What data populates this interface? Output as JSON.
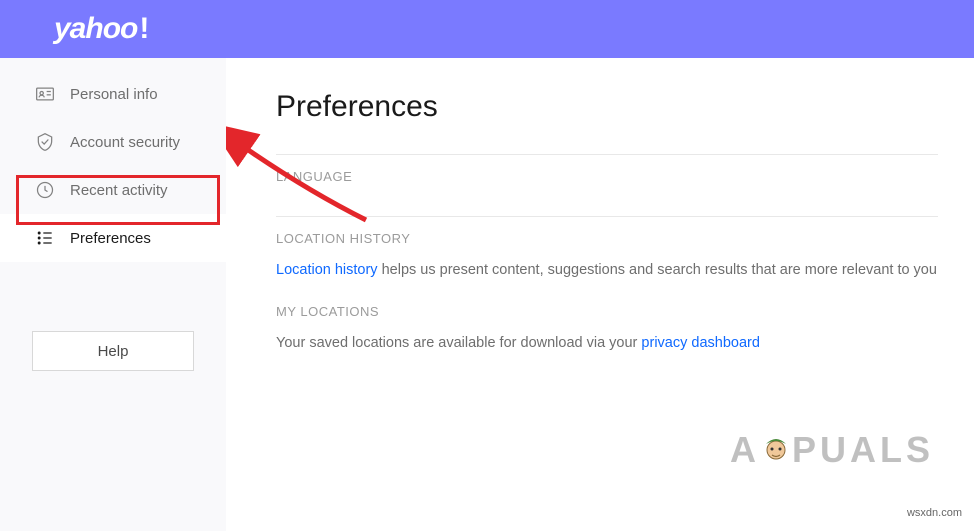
{
  "header": {
    "logo_text": "yahoo"
  },
  "sidebar": {
    "items": [
      {
        "label": "Personal info",
        "icon": "id-card-icon",
        "active": false
      },
      {
        "label": "Account security",
        "icon": "shield-icon",
        "active": false
      },
      {
        "label": "Recent activity",
        "icon": "clock-icon",
        "active": false
      },
      {
        "label": "Preferences",
        "icon": "list-icon",
        "active": true
      }
    ],
    "help_label": "Help"
  },
  "content": {
    "title": "Preferences",
    "sections": {
      "language": {
        "header": "LANGUAGE"
      },
      "location_history": {
        "header": "LOCATION HISTORY",
        "link_text": "Location history",
        "desc_suffix": " helps us present content, suggestions and search results that are more relevant to you"
      },
      "my_locations": {
        "header": "MY LOCATIONS",
        "desc_prefix": "Your saved locations are available for download via your ",
        "link_text": "privacy dashboard"
      }
    }
  },
  "annotations": {
    "watermark_text": "A  PUALS",
    "source_url": "wsxdn.com"
  }
}
